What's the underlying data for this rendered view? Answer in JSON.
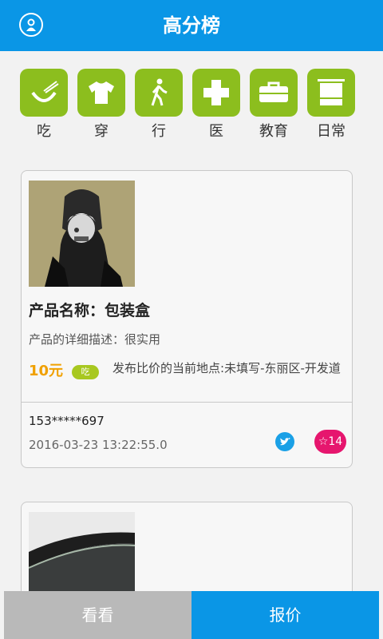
{
  "header": {
    "title": "高分榜",
    "avatar_icon": "user-icon"
  },
  "categories": [
    {
      "label": "吃",
      "icon": "bowl-icon"
    },
    {
      "label": "穿",
      "icon": "shirt-icon"
    },
    {
      "label": "行",
      "icon": "walking-icon"
    },
    {
      "label": "医",
      "icon": "medical-cross-icon"
    },
    {
      "label": "教育",
      "icon": "bag-icon"
    },
    {
      "label": "日常",
      "icon": "towel-icon"
    }
  ],
  "listings": [
    {
      "name": "产品名称：包装盒",
      "description": "产品的详细描述：很实用",
      "price": "10元",
      "tag": "吃",
      "location": "发布比价的当前地点:未填写-东丽区-开发道",
      "phone": "153*****697",
      "time": "2016-03-23 13:22:55.0",
      "favorites": "☆14"
    }
  ],
  "bottom_bar": {
    "left": "看看",
    "right": "报价"
  },
  "colors": {
    "accent": "#0a96e6",
    "category_green": "#8cbe1e",
    "price": "#f0a000",
    "favorite": "#e6166e"
  }
}
